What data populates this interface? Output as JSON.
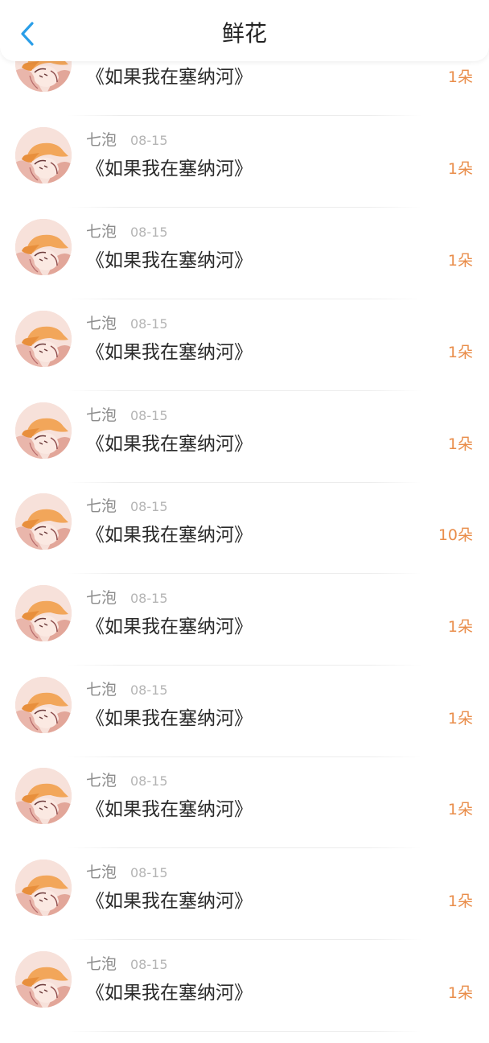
{
  "header": {
    "title": "鲜花",
    "back_icon": "chevron-left-icon",
    "accent": "#2a9ee8"
  },
  "count_color": "#e98d4a",
  "items": [
    {
      "name": "",
      "date": "",
      "work": "《如果我在塞纳河》",
      "count": "1朵"
    },
    {
      "name": "七泡",
      "date": "08-15",
      "work": "《如果我在塞纳河》",
      "count": "1朵"
    },
    {
      "name": "七泡",
      "date": "08-15",
      "work": "《如果我在塞纳河》",
      "count": "1朵"
    },
    {
      "name": "七泡",
      "date": "08-15",
      "work": "《如果我在塞纳河》",
      "count": "1朵"
    },
    {
      "name": "七泡",
      "date": "08-15",
      "work": "《如果我在塞纳河》",
      "count": "1朵"
    },
    {
      "name": "七泡",
      "date": "08-15",
      "work": "《如果我在塞纳河》",
      "count": "10朵"
    },
    {
      "name": "七泡",
      "date": "08-15",
      "work": "《如果我在塞纳河》",
      "count": "1朵"
    },
    {
      "name": "七泡",
      "date": "08-15",
      "work": "《如果我在塞纳河》",
      "count": "1朵"
    },
    {
      "name": "七泡",
      "date": "08-15",
      "work": "《如果我在塞纳河》",
      "count": "1朵"
    },
    {
      "name": "七泡",
      "date": "08-15",
      "work": "《如果我在塞纳河》",
      "count": "1朵"
    },
    {
      "name": "七泡",
      "date": "08-15",
      "work": "《如果我在塞纳河》",
      "count": "1朵"
    }
  ]
}
